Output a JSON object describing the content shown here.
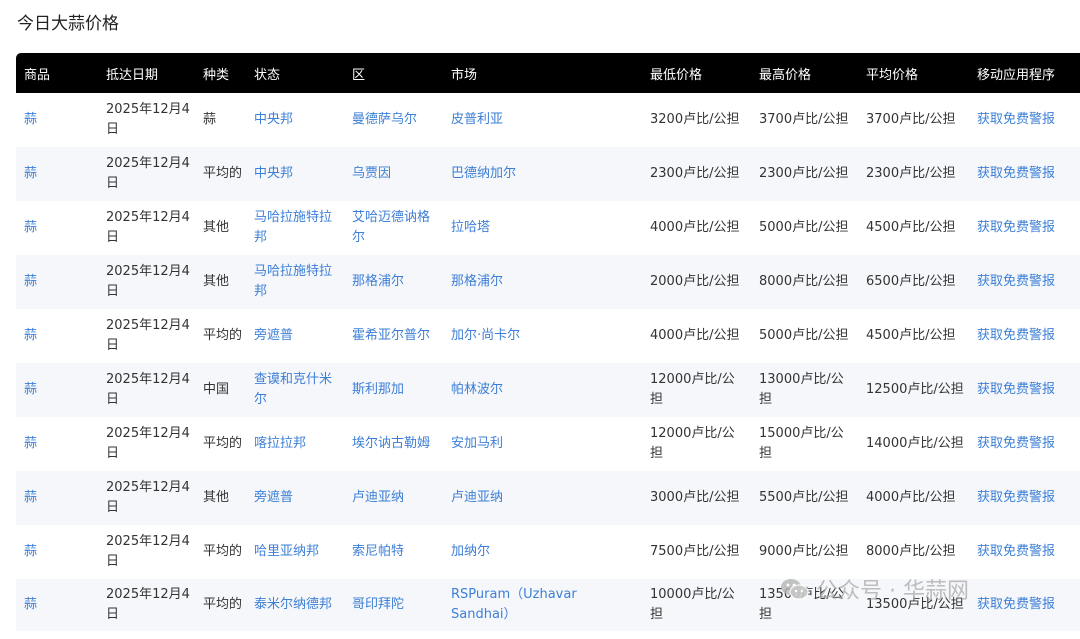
{
  "page": {
    "title": "今日大蒜价格"
  },
  "table": {
    "headers": [
      "商品",
      "抵达日期",
      "种类",
      "状态",
      "区",
      "市场",
      "最低价格",
      "最高价格",
      "平均价格",
      "移动应用程序"
    ],
    "rows": [
      [
        "蒜",
        "2025年12月4日",
        "蒜",
        "中央邦",
        "曼德萨乌尔",
        "皮普利亚",
        "3200卢比/公担",
        "3700卢比/公担",
        "3700卢比/公担",
        "获取免费警报"
      ],
      [
        "蒜",
        "2025年12月4日",
        "平均的",
        "中央邦",
        "乌贾因",
        "巴德纳加尔",
        "2300卢比/公担",
        "2300卢比/公担",
        "2300卢比/公担",
        "获取免费警报"
      ],
      [
        "蒜",
        "2025年12月4日",
        "其他",
        "马哈拉施特拉邦",
        "艾哈迈德讷格尔",
        "拉哈塔",
        "4000卢比/公担",
        "5000卢比/公担",
        "4500卢比/公担",
        "获取免费警报"
      ],
      [
        "蒜",
        "2025年12月4日",
        "其他",
        "马哈拉施特拉邦",
        "那格浦尔",
        "那格浦尔",
        "2000卢比/公担",
        "8000卢比/公担",
        "6500卢比/公担",
        "获取免费警报"
      ],
      [
        "蒜",
        "2025年12月4日",
        "平均的",
        "旁遮普",
        "霍希亚尔普尔",
        "加尔·尚卡尔",
        "4000卢比/公担",
        "5000卢比/公担",
        "4500卢比/公担",
        "获取免费警报"
      ],
      [
        "蒜",
        "2025年12月4日",
        "中国",
        "查谟和克什米尔",
        "斯利那加",
        "帕林波尔",
        "12000卢比/公担",
        "13000卢比/公担",
        "12500卢比/公担",
        "获取免费警报"
      ],
      [
        "蒜",
        "2025年12月4日",
        "平均的",
        "喀拉拉邦",
        "埃尔讷古勒姆",
        "安加马利",
        "12000卢比/公担",
        "15000卢比/公担",
        "14000卢比/公担",
        "获取免费警报"
      ],
      [
        "蒜",
        "2025年12月4日",
        "其他",
        "旁遮普",
        "卢迪亚纳",
        "卢迪亚纳",
        "3000卢比/公担",
        "5500卢比/公担",
        "4000卢比/公担",
        "获取免费警报"
      ],
      [
        "蒜",
        "2025年12月4日",
        "平均的",
        "哈里亚纳邦",
        "索尼帕特",
        "加纳尔",
        "7500卢比/公担",
        "9000卢比/公担",
        "8000卢比/公担",
        "获取免费警报"
      ],
      [
        "蒜",
        "2025年12月4日",
        "平均的",
        "泰米尔纳德邦",
        "哥印拜陀",
        "RSPuram（Uzhavar Sandhai）",
        "10000卢比/公担",
        "13500卢比/公担",
        "13500卢比/公担",
        "获取免费警报"
      ]
    ]
  },
  "watermark": {
    "text": "公众号 · 华蒜网",
    "icon": "wechat-icon"
  },
  "colors": {
    "header_bg": "#000000",
    "link": "#3d7fd6",
    "stripe": "#f5f7fb"
  }
}
